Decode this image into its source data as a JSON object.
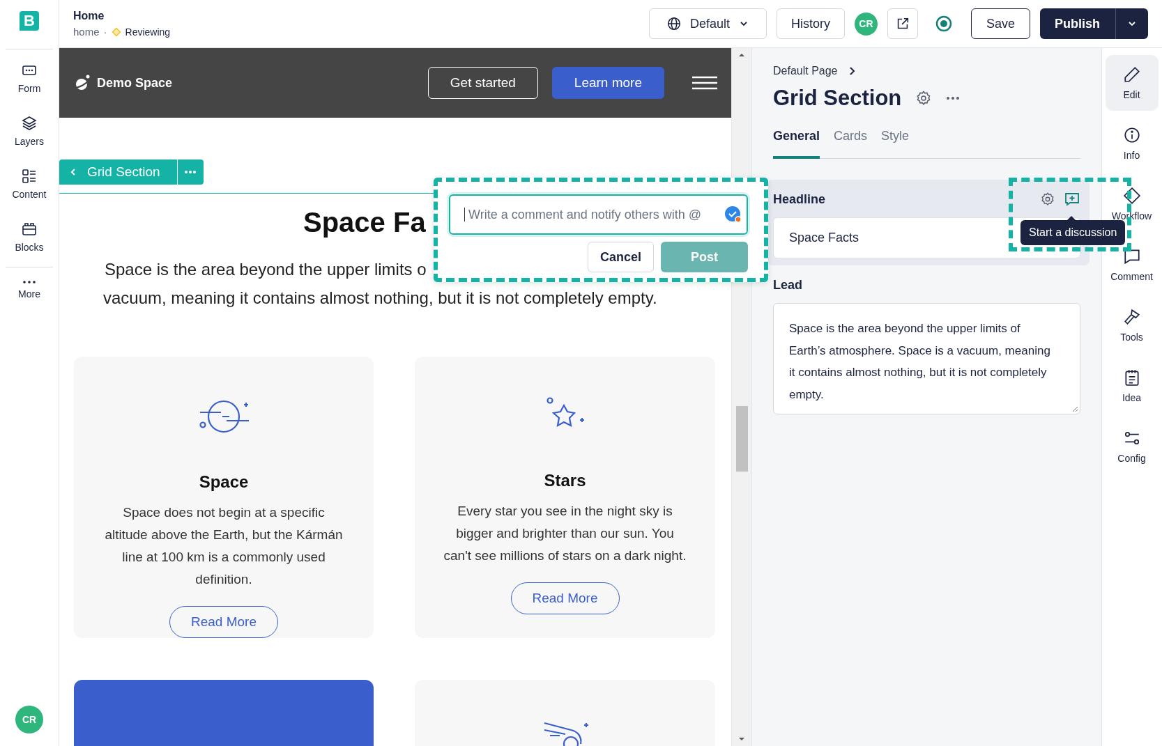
{
  "sidebar": {
    "logo": "B",
    "items": [
      {
        "label": "Form"
      },
      {
        "label": "Layers"
      },
      {
        "label": "Content"
      },
      {
        "label": "Blocks"
      },
      {
        "label": "More"
      }
    ],
    "avatar": "CR"
  },
  "topbar": {
    "title": "Home",
    "path": "home",
    "separator": "·",
    "status": "Reviewing",
    "locale": "Default",
    "history": "History",
    "avatar": "CR",
    "save": "Save",
    "publish": "Publish"
  },
  "preview": {
    "brand": "Demo Space",
    "buttons": [
      {
        "label": "Get started",
        "kind": "outline"
      },
      {
        "label": "Learn more",
        "kind": "solid"
      }
    ],
    "section_chip": "Grid Section",
    "heading": "Space Fa",
    "lead_lines": [
      "Space is the area beyond the upper limits o",
      "vacuum, meaning it contains almost nothing, but it is not completely empty."
    ],
    "cards": [
      {
        "kind": "feature",
        "title": "Space",
        "text": "Space does not begin at a specific altitude above the Earth, but the Kármán line at 100 km is a commonly used definition.",
        "button": "Read More"
      },
      {
        "kind": "feature",
        "title": "Stars",
        "text": "Every star you see in the night sky is bigger and brighter than our sun. You can't see millions of stars on a dark night.",
        "button": "Read More"
      },
      {
        "kind": "accent"
      },
      {
        "kind": "feature"
      }
    ]
  },
  "comment_popup": {
    "placeholder": "Write a comment and notify others with @",
    "buttons": [
      {
        "label": "Cancel",
        "disabled": false
      },
      {
        "label": "Post",
        "disabled": true
      }
    ]
  },
  "panel": {
    "breadcrumb": "Default Page",
    "title": "Grid Section",
    "tabs": [
      {
        "label": "General",
        "selected": true
      },
      {
        "label": "Cards",
        "selected": false
      },
      {
        "label": "Style",
        "selected": false
      }
    ],
    "fields": [
      {
        "label": "Headline",
        "kind": "input",
        "value": "Space Facts",
        "highlighted": true
      },
      {
        "label": "Lead",
        "kind": "textarea",
        "value": "Space is the area beyond the upper limits of Earth’s atmosphere. Space is a vacuum, meaning it contains almost nothing, but it is not completely empty.",
        "highlighted": false
      }
    ],
    "tooltip": "Start a discussion"
  },
  "rail": {
    "items": [
      {
        "label": "Edit",
        "selected": true
      },
      {
        "label": "Info",
        "selected": false
      },
      {
        "label": "Workflow",
        "selected": false
      },
      {
        "label": "Comment",
        "selected": false
      },
      {
        "label": "Tools",
        "selected": false
      },
      {
        "label": "Idea",
        "selected": false
      },
      {
        "label": "Config",
        "selected": false
      }
    ]
  }
}
